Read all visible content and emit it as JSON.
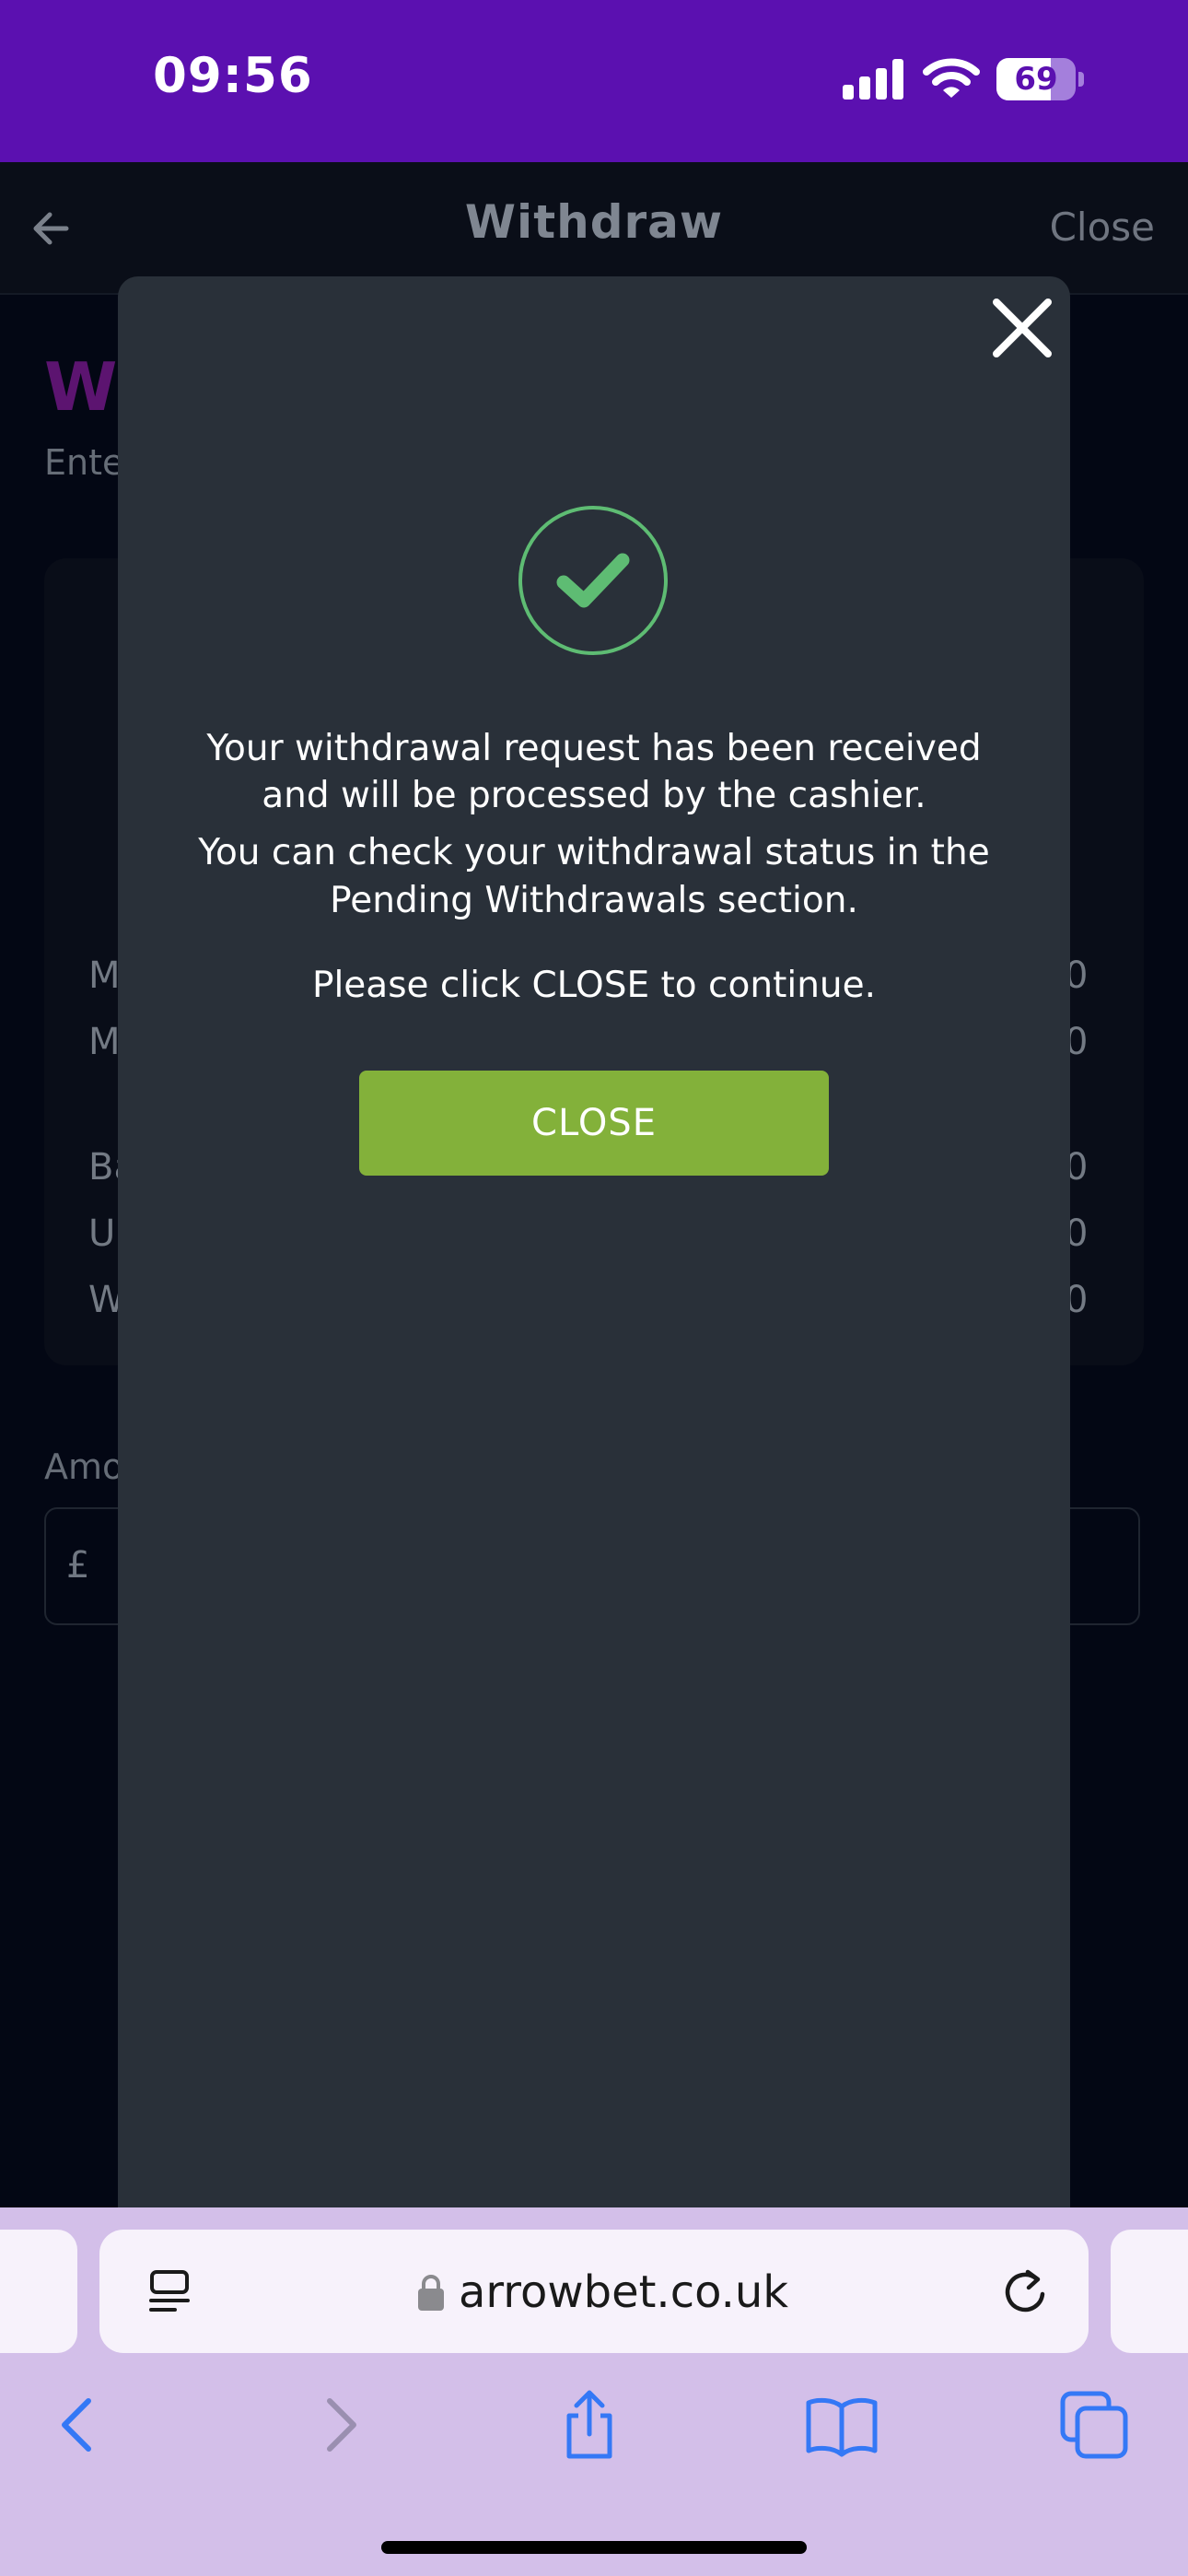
{
  "status_bar": {
    "time": "09:56",
    "battery": "69",
    "battery_level": 0.69
  },
  "header": {
    "title": "Withdraw",
    "close_label": "Close",
    "back_icon": "back-arrow-icon"
  },
  "background": {
    "heading": "Wi",
    "subtitle": "Ente",
    "rows_left": [
      "M",
      "M",
      "Ba",
      "Ur",
      "W"
    ],
    "rows_right": [
      "0",
      "0",
      "0",
      "0",
      "0"
    ],
    "amount_label": "Amo",
    "currency_symbol": "£"
  },
  "modal": {
    "close_icon": "close-x-icon",
    "success_icon": "checkmark-circle-icon",
    "message_1_line_1": "Your withdrawal request has been received",
    "message_1_line_2": "and will be processed by the cashier.",
    "message_2_line_1": "You can check your withdrawal status in the",
    "message_2_line_2": "Pending Withdrawals section.",
    "message_3": "Please click CLOSE to continue.",
    "button_label": "CLOSE",
    "accent_color": "#83b13a",
    "success_color": "#5ebc73"
  },
  "browser": {
    "url": "arrowbet.co.uk",
    "icons": [
      "reader-icon",
      "lock-icon",
      "reload-icon",
      "back-icon",
      "forward-icon",
      "share-icon",
      "bookmarks-icon",
      "tabs-icon"
    ]
  },
  "colors": {
    "status_bar": "#5b10b0",
    "safari_bar": "#d3bfe9",
    "modal_bg": "#293039"
  }
}
